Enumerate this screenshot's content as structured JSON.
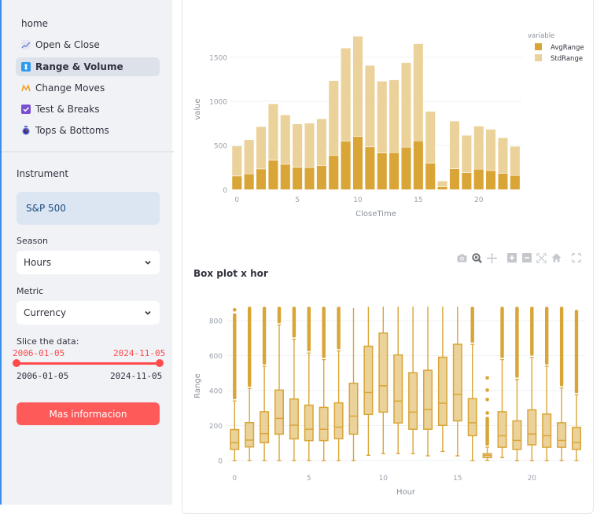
{
  "sidebar": {
    "nav": [
      {
        "label": "home",
        "icon": "",
        "active": false
      },
      {
        "label": "Open & Close",
        "icon": "chart-increasing-icon",
        "active": false
      },
      {
        "label": "Range & Volume",
        "icon": "up-down-arrow-icon",
        "active": true
      },
      {
        "label": "Change Moves",
        "icon": "zigzag-icon",
        "active": false
      },
      {
        "label": "Test & Breaks",
        "icon": "check-box-icon",
        "active": false
      },
      {
        "label": "Tops & Bottoms",
        "icon": "stopwatch-icon",
        "active": false
      }
    ],
    "instrument_label": "Instrument",
    "instrument_value": "S&P 500",
    "season_label": "Season",
    "season_value": "Hours",
    "metric_label": "Metric",
    "metric_value": "Currency",
    "slice_label": "Slice the data:",
    "slice_start": "2006-01-05",
    "slice_end": "2024-11-05",
    "slice_min": "2006-01-05",
    "slice_max": "2024-11-05",
    "button_label": "Mas informacion",
    "accent_color": "#ff4b4b"
  },
  "modebar": [
    "camera-icon",
    "zoom-icon",
    "pan-icon",
    "zoom-in-icon",
    "zoom-out-icon",
    "autoscale-icon",
    "reset-axes-icon",
    "fullscreen-icon"
  ],
  "chart_data": [
    {
      "type": "bar",
      "stacked": true,
      "title": "",
      "xlabel": "CloseTime",
      "ylabel": "value",
      "categories": [
        0,
        1,
        2,
        3,
        4,
        5,
        6,
        7,
        8,
        9,
        10,
        11,
        12,
        13,
        14,
        15,
        16,
        17,
        18,
        19,
        20,
        21,
        22,
        23
      ],
      "xticks": [
        0,
        5,
        10,
        15,
        20
      ],
      "yticks": [
        0,
        500,
        1000,
        1500
      ],
      "ylim": [
        0,
        1780
      ],
      "legend_title": "variable",
      "legend_position": "top-right",
      "series": [
        {
          "name": "AvgRange",
          "color": "#d9a536",
          "values": [
            155,
            179,
            235,
            333,
            288,
            253,
            250,
            274,
            387,
            550,
            604,
            485,
            416,
            419,
            482,
            553,
            300,
            32,
            238,
            193,
            232,
            217,
            184,
            161
          ]
        },
        {
          "name": "StdRange",
          "color": "#ebd29a",
          "values": [
            339,
            386,
            479,
            640,
            560,
            491,
            503,
            529,
            848,
            1054,
            1134,
            922,
            813,
            825,
            958,
            1101,
            587,
            66,
            539,
            423,
            488,
            467,
            405,
            330
          ]
        }
      ]
    },
    {
      "type": "box",
      "title": "Box plot x hor",
      "xlabel": "Hour",
      "ylabel": "Range",
      "xticks": [
        0,
        5,
        10,
        15,
        20
      ],
      "yticks": [
        0,
        200,
        400,
        600,
        800
      ],
      "ylim": [
        -20,
        880
      ],
      "color": "#d9a536",
      "boxes": [
        {
          "x": 0,
          "lower": 0,
          "q1": 64,
          "median": 102,
          "q3": 177,
          "upper": 341,
          "outliers_to": 842,
          "top_outlier": 862
        },
        {
          "x": 1,
          "lower": 0,
          "q1": 78,
          "median": 117,
          "q3": 217,
          "upper": 412,
          "outliers_to": 880
        },
        {
          "x": 2,
          "lower": 0,
          "q1": 102,
          "median": 154,
          "q3": 279,
          "upper": 539,
          "outliers_to": 880
        },
        {
          "x": 3,
          "lower": 0,
          "q1": 151,
          "median": 241,
          "q3": 403,
          "upper": 776,
          "outliers_to": 880
        },
        {
          "x": 4,
          "lower": 0,
          "q1": 124,
          "median": 202,
          "q3": 352,
          "upper": 694,
          "outliers_to": 880
        },
        {
          "x": 5,
          "lower": 0,
          "q1": 114,
          "median": 179,
          "q3": 317,
          "upper": 615,
          "outliers_to": 880
        },
        {
          "x": 6,
          "lower": 0,
          "q1": 114,
          "median": 179,
          "q3": 304,
          "upper": 577,
          "outliers_to": 880
        },
        {
          "x": 7,
          "lower": 0,
          "q1": 125,
          "median": 191,
          "q3": 330,
          "upper": 627,
          "outliers_to": 880
        },
        {
          "x": 8,
          "lower": 0,
          "q1": 151,
          "median": 254,
          "q3": 442,
          "upper": 872,
          "outliers_to": 880
        },
        {
          "x": 9,
          "lower": 30,
          "q1": 264,
          "median": 389,
          "q3": 654,
          "upper": 880
        },
        {
          "x": 10,
          "lower": 40,
          "q1": 277,
          "median": 428,
          "q3": 729,
          "upper": 880
        },
        {
          "x": 11,
          "lower": 40,
          "q1": 215,
          "median": 340,
          "q3": 604,
          "upper": 880
        },
        {
          "x": 12,
          "lower": 40,
          "q1": 179,
          "median": 277,
          "q3": 502,
          "upper": 880
        },
        {
          "x": 13,
          "lower": 27,
          "q1": 179,
          "median": 292,
          "q3": 516,
          "upper": 880
        },
        {
          "x": 14,
          "lower": 52,
          "q1": 201,
          "median": 328,
          "q3": 591,
          "upper": 880
        },
        {
          "x": 15,
          "lower": 27,
          "q1": 227,
          "median": 379,
          "q3": 665,
          "upper": 880
        },
        {
          "x": 16,
          "lower": 0,
          "q1": 142,
          "median": 216,
          "q3": 354,
          "upper": 664,
          "outliers_to": 880
        },
        {
          "x": 17,
          "lower": 1,
          "q1": 17,
          "median": 30,
          "q3": 39,
          "upper": 76,
          "outliers_to": 250,
          "sparse_outliers": [
            272,
            349,
            403,
            473
          ]
        },
        {
          "x": 18,
          "lower": 17,
          "q1": 76,
          "median": 142,
          "q3": 279,
          "upper": 577,
          "outliers_to": 880
        },
        {
          "x": 19,
          "lower": 0,
          "q1": 64,
          "median": 115,
          "q3": 227,
          "upper": 464,
          "outliers_to": 880
        },
        {
          "x": 20,
          "lower": 0,
          "q1": 90,
          "median": 152,
          "q3": 290,
          "upper": 590,
          "outliers_to": 880
        },
        {
          "x": 21,
          "lower": 0,
          "q1": 76,
          "median": 142,
          "q3": 266,
          "upper": 539,
          "outliers_to": 880
        },
        {
          "x": 22,
          "lower": 0,
          "q1": 76,
          "median": 115,
          "q3": 216,
          "upper": 415,
          "outliers_to": 880
        },
        {
          "x": 23,
          "lower": 0,
          "q1": 64,
          "median": 103,
          "q3": 190,
          "upper": 376,
          "outliers_to": 862
        }
      ]
    }
  ]
}
